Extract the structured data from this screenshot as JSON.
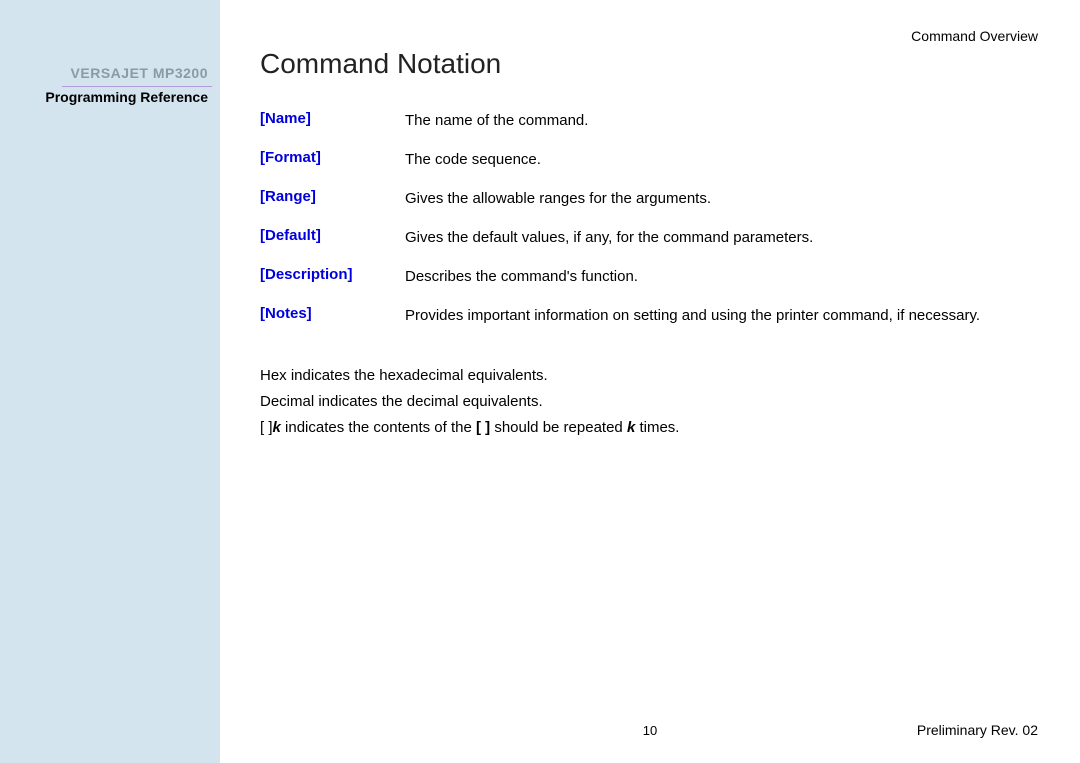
{
  "sidebar": {
    "product_name": "VERSAJET MP3200",
    "doc_title": "Programming Reference"
  },
  "header": {
    "section": "Command Overview"
  },
  "heading": "Command Notation",
  "definitions": [
    {
      "label": "[Name]",
      "val": "The name of the command."
    },
    {
      "label": "[Format]",
      "val": "The code sequence."
    },
    {
      "label": "[Range]",
      "val": "Gives the allowable ranges for the arguments."
    },
    {
      "label": "[Default]",
      "val": "Gives the default values, if any, for the command parameters."
    },
    {
      "label": "[Description]",
      "val": "Describes the command's function."
    },
    {
      "label": "[Notes]",
      "val": "Provides important information on setting and using the printer command, if necessary."
    }
  ],
  "notes": {
    "line1": "Hex indicates the hexadecimal equivalents.",
    "line2": "Decimal indicates the decimal equivalents.",
    "line3_prefix": "[ ]",
    "line3_k": "k",
    "line3_mid": " indicates the contents of the ",
    "line3_brackets": "[ ]",
    "line3_mid2": " should be repeated ",
    "line3_k2": "k",
    "line3_suffix": " times."
  },
  "footer": {
    "page_number": "10",
    "revision": "Preliminary Rev. 02"
  }
}
